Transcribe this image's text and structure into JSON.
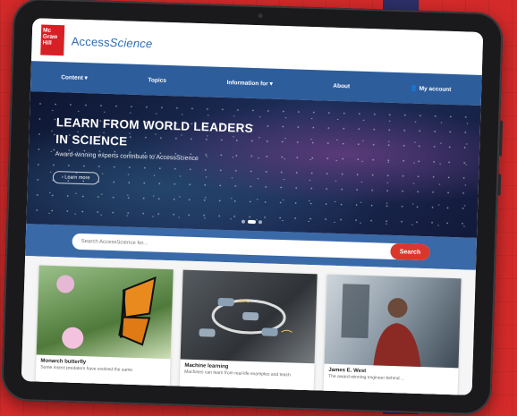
{
  "site": {
    "logo": "Mc Graw Hill",
    "brand_a": "Access",
    "brand_b": "Science"
  },
  "nav": {
    "content": "Content ▾",
    "topics": "Topics",
    "info": "Information for ▾",
    "about": "About",
    "account": "My account"
  },
  "hero": {
    "title_line1": "LEARN FROM WORLD LEADERS",
    "title_line2": "IN SCIENCE",
    "subtitle": "Award-winning experts contribute to AccessScience",
    "learn_more": "Learn more"
  },
  "search": {
    "placeholder": "Search AccessScience for...",
    "button": "Search"
  },
  "cards": [
    {
      "title": "Monarch butterfly",
      "desc": "Some insect predators have evolved the same"
    },
    {
      "title": "Machine learning",
      "desc": "Machines can learn from real-life examples and teach"
    },
    {
      "title": "James E. West",
      "desc": "The award-winning engineer behind ..."
    }
  ],
  "colors": {
    "brand_red": "#d81f26",
    "nav_blue": "#2e5d9c",
    "search_red": "#d9372b",
    "page_red": "#d42a2a"
  }
}
